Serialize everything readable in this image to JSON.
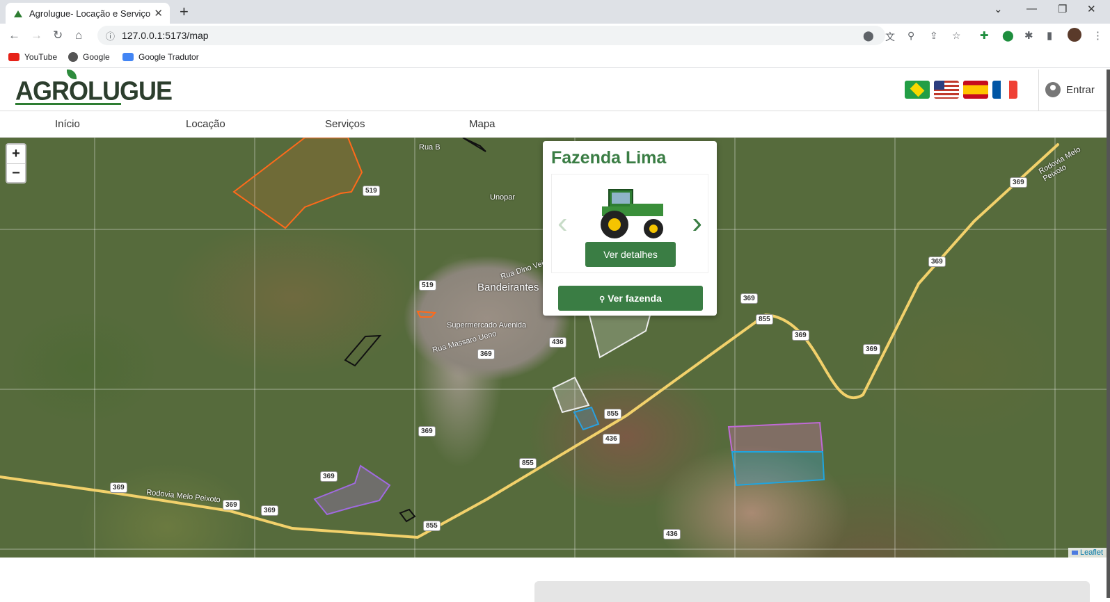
{
  "browser": {
    "tab_title": "Agrolugue- Locação e Serviço",
    "url": "127.0.0.1:5173/map",
    "bookmarks": [
      {
        "label": "YouTube"
      },
      {
        "label": "Google"
      },
      {
        "label": "Google Tradutor"
      }
    ]
  },
  "header": {
    "logo": "AGROLUGUE",
    "languages": [
      "pt-BR",
      "en-US",
      "es",
      "fr"
    ],
    "login_label": "Entrar"
  },
  "nav": {
    "items": [
      "Início",
      "Locação",
      "Serviços",
      "Mapa"
    ]
  },
  "map": {
    "zoom_in": "+",
    "zoom_out": "−",
    "attribution": "Leaflet",
    "places": {
      "city": "Bandeirantes",
      "unopar": "Unopar",
      "market": "Supermercado Avenida",
      "rua_b": "Rua B",
      "rua_massaro": "Rua Massaro Ueno",
      "rua_dino": "Rua Dino Veiga",
      "rodovia": "Rodovia Melo Peixoto",
      "rodovia2": "Rodovia Melo Peixoto"
    },
    "road_markers": [
      "519",
      "519",
      "369",
      "369",
      "369",
      "369",
      "436",
      "436",
      "436",
      "855",
      "855",
      "855",
      "855",
      "369",
      "369",
      "369",
      "369",
      "369",
      "369",
      "369"
    ]
  },
  "popup": {
    "farm_name": "Fazenda Lima",
    "details_button": "Ver detalhes",
    "farm_button": "Ver fazenda",
    "prev_arrow": "‹",
    "next_arrow": "›"
  },
  "colors": {
    "brand_green": "#3a7d44",
    "road_yellow": "#f2d16b"
  }
}
